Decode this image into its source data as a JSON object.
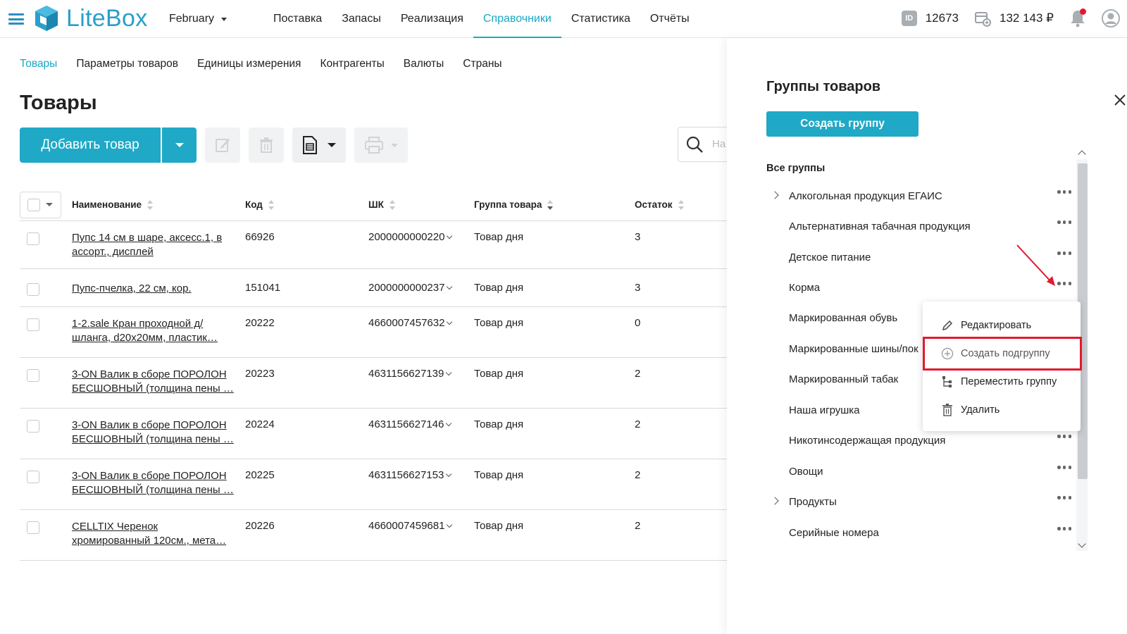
{
  "header": {
    "app_name": "LiteBox",
    "month": "February",
    "nav": [
      {
        "label": "Поставка",
        "active": false
      },
      {
        "label": "Запасы",
        "active": false
      },
      {
        "label": "Реализация",
        "active": false
      },
      {
        "label": "Справочники",
        "active": true
      },
      {
        "label": "Статистика",
        "active": false
      },
      {
        "label": "Отчёты",
        "active": false
      }
    ],
    "id_badge": "ID",
    "user_id": "12673",
    "balance": "132 143 ₽"
  },
  "subnav": [
    {
      "label": "Товары",
      "active": true
    },
    {
      "label": "Параметры товаров",
      "active": false
    },
    {
      "label": "Единицы измерения",
      "active": false
    },
    {
      "label": "Контрагенты",
      "active": false
    },
    {
      "label": "Валюты",
      "active": false
    },
    {
      "label": "Страны",
      "active": false
    }
  ],
  "page_title": "Товары",
  "toolbar": {
    "add_label": "Добавить товар",
    "search_placeholder": "На"
  },
  "table": {
    "columns": [
      "Наименование",
      "Код",
      "ШК",
      "Группа товара",
      "Остаток"
    ],
    "rows": [
      {
        "name": "Пупс 14 см в шаре, аксесс.1, в ассорт., дисплей",
        "code": "66926",
        "barcode": "2000000000220",
        "group": "Товар дня",
        "rest": "3"
      },
      {
        "name": "Пупс-пчелка, 22 см, кор.",
        "code": "151041",
        "barcode": "2000000000237",
        "group": "Товар дня",
        "rest": "3"
      },
      {
        "name": "1-2.sale Кран проходной д/шланга, d20x20мм, пластик…",
        "code": "20222",
        "barcode": "4660007457632",
        "group": "Товар дня",
        "rest": "0"
      },
      {
        "name": "3-ON Валик в сборе ПОРОЛОН БЕСШОВНЫЙ (толщина пены …",
        "code": "20223",
        "barcode": "4631156627139",
        "group": "Товар дня",
        "rest": "2"
      },
      {
        "name": "3-ON Валик в сборе ПОРОЛОН БЕСШОВНЫЙ (толщина пены …",
        "code": "20224",
        "barcode": "4631156627146",
        "group": "Товар дня",
        "rest": "2"
      },
      {
        "name": "3-ON Валик в сборе ПОРОЛОН БЕСШОВНЫЙ (толщина пены …",
        "code": "20225",
        "barcode": "4631156627153",
        "group": "Товар дня",
        "rest": "2"
      },
      {
        "name": "CELLTIX Черенок хромированный 120см., мета…",
        "code": "20226",
        "barcode": "4660007459681",
        "group": "Товар дня",
        "rest": "2"
      }
    ]
  },
  "panel": {
    "title": "Группы товаров",
    "create_label": "Создать группу",
    "all_groups": "Все группы",
    "groups": [
      {
        "label": "Алкогольная продукция ЕГАИС",
        "expandable": true
      },
      {
        "label": "Альтернативная табачная продукция",
        "expandable": false
      },
      {
        "label": "Детское питание",
        "expandable": false
      },
      {
        "label": "Корма",
        "expandable": false
      },
      {
        "label": "Маркированная обувь",
        "expandable": false
      },
      {
        "label": "Маркированные шины/пок",
        "expandable": false
      },
      {
        "label": "Маркированный табак",
        "expandable": false
      },
      {
        "label": "Наша игрушка",
        "expandable": false
      },
      {
        "label": "Никотинсодержащая продукция",
        "expandable": false
      },
      {
        "label": "Овощи",
        "expandable": false
      },
      {
        "label": "Продукты",
        "expandable": true
      },
      {
        "label": "Серийные номера",
        "expandable": false
      }
    ]
  },
  "context_menu": {
    "items": [
      {
        "label": "Редактировать",
        "icon": "pencil-icon"
      },
      {
        "label": "Создать подгруппу",
        "icon": "plus-circle-icon"
      },
      {
        "label": "Переместить группу",
        "icon": "tree-move-icon"
      },
      {
        "label": "Удалить",
        "icon": "trash-icon"
      }
    ]
  },
  "colors": {
    "accent": "#1fa9c6",
    "highlight": "#e3192f"
  }
}
